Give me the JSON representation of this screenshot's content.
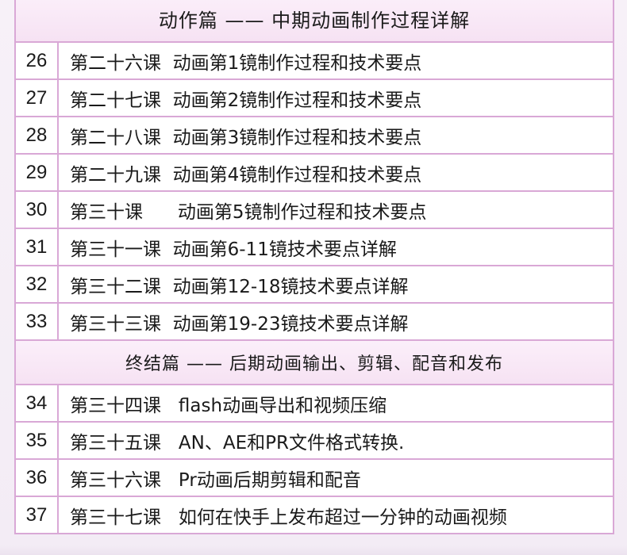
{
  "section1": {
    "title": "动作篇 —— 中期动画制作过程详解",
    "rows": [
      {
        "num": "26",
        "title": "第二十六课  动画第1镜制作过程和技术要点"
      },
      {
        "num": "27",
        "title": "第二十七课  动画第2镜制作过程和技术要点"
      },
      {
        "num": "28",
        "title": "第二十八课  动画第3镜制作过程和技术要点"
      },
      {
        "num": "29",
        "title": "第二十九课  动画第4镜制作过程和技术要点"
      },
      {
        "num": "30",
        "title": "第三十课      动画第5镜制作过程和技术要点"
      },
      {
        "num": "31",
        "title": "第三十一课  动画第6-11镜技术要点详解"
      },
      {
        "num": "32",
        "title": "第三十二课  动画第12-18镜技术要点详解"
      },
      {
        "num": "33",
        "title": "第三十三课  动画第19-23镜技术要点详解"
      }
    ]
  },
  "section2": {
    "title": "终结篇 —— 后期动画输出、剪辑、配音和发布",
    "rows": [
      {
        "num": "34",
        "title": "第三十四课   flash动画导出和视频压缩"
      },
      {
        "num": "35",
        "title": "第三十五课   AN、AE和PR文件格式转换."
      },
      {
        "num": "36",
        "title": "第三十六课   Pr动画后期剪辑和配音"
      },
      {
        "num": "37",
        "title": "第三十七课   如何在快手上发布超过一分钟的动画视频"
      }
    ]
  }
}
